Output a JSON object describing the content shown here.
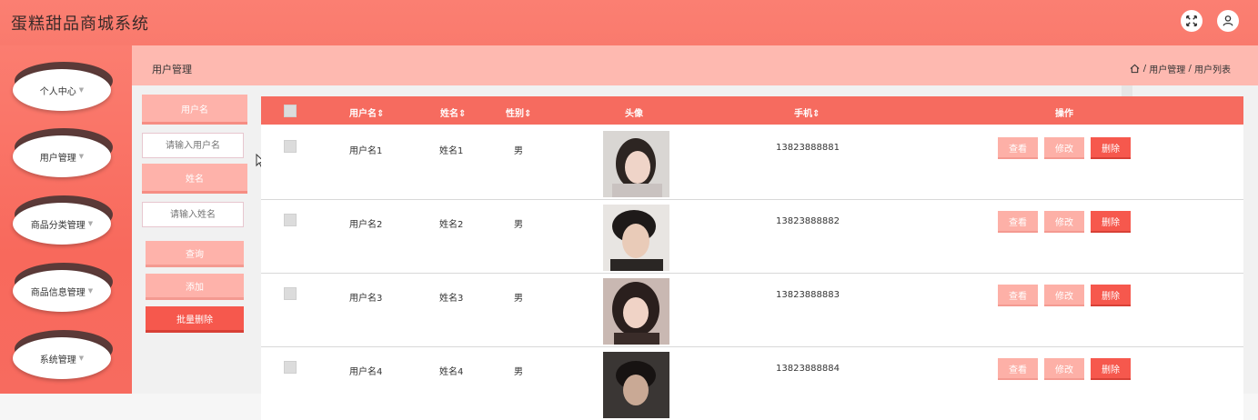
{
  "app": {
    "title": "蛋糕甜品商城系统"
  },
  "icons": {
    "fullscreen": "expand-arrows-icon",
    "user": "user-icon"
  },
  "sidebar": {
    "items": [
      {
        "label": "个人中心"
      },
      {
        "label": "用户管理"
      },
      {
        "label": "商品分类管理"
      },
      {
        "label": "商品信息管理"
      },
      {
        "label": "系统管理"
      }
    ]
  },
  "header": {
    "title": "用户管理",
    "breadcrumb": [
      "用户管理",
      "用户列表"
    ],
    "breadcrumb_separator": "/"
  },
  "search": {
    "username_label": "用户名",
    "username_placeholder": "请输入用户名",
    "name_label": "姓名",
    "name_placeholder": "请输入姓名",
    "query_button": "查询",
    "add_button": "添加",
    "batch_delete_button": "批量删除"
  },
  "table": {
    "columns": [
      "用户名",
      "姓名",
      "性别",
      "头像",
      "手机",
      "操作"
    ],
    "rows": [
      {
        "username": "用户名1",
        "name": "姓名1",
        "gender": "男",
        "phone": "13823888881",
        "view": "查看",
        "edit": "修改",
        "delete": "删除"
      },
      {
        "username": "用户名2",
        "name": "姓名2",
        "gender": "男",
        "phone": "13823888882",
        "view": "查看",
        "edit": "修改",
        "delete": "删除"
      },
      {
        "username": "用户名3",
        "name": "姓名3",
        "gender": "男",
        "phone": "13823888883",
        "view": "查看",
        "edit": "修改",
        "delete": "删除"
      },
      {
        "username": "用户名4",
        "name": "姓名4",
        "gender": "男",
        "phone": "13823888884",
        "view": "查看",
        "edit": "修改",
        "delete": "删除"
      }
    ]
  },
  "colors": {
    "primary": "#f66b5f",
    "light": "#feb2aa",
    "danger": "#f6584d",
    "header_band": "#feb9b0"
  }
}
